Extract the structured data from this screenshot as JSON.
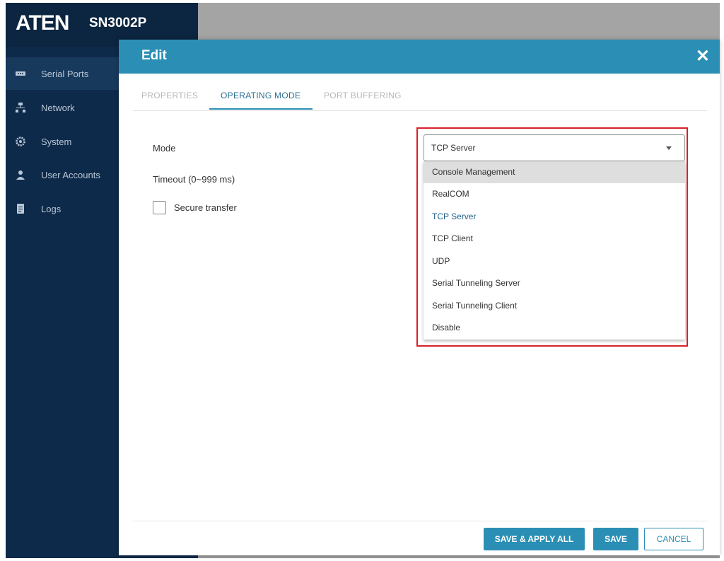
{
  "brand": {
    "logo": "ATEN",
    "model": "SN3002P"
  },
  "sidebar": {
    "items": [
      {
        "label": "Serial Ports",
        "icon": "serial-port-icon"
      },
      {
        "label": "Network",
        "icon": "network-icon"
      },
      {
        "label": "System",
        "icon": "gear-icon"
      },
      {
        "label": "User Accounts",
        "icon": "user-icon"
      },
      {
        "label": "Logs",
        "icon": "document-icon"
      }
    ]
  },
  "dialog": {
    "title": "Edit",
    "close_label": "✕",
    "tabs": [
      {
        "label": "PROPERTIES"
      },
      {
        "label": "OPERATING MODE"
      },
      {
        "label": "PORT BUFFERING"
      }
    ],
    "fields": {
      "mode_label": "Mode",
      "timeout_label": "Timeout (0~999 ms)",
      "secure_transfer_label": "Secure transfer"
    },
    "mode_select": {
      "value": "TCP Server",
      "options": [
        "Console Management",
        "RealCOM",
        "TCP Server",
        "TCP Client",
        "UDP",
        "Serial Tunneling Server",
        "Serial Tunneling Client",
        "Disable"
      ]
    },
    "buttons": {
      "save_apply_all": "SAVE & APPLY ALL",
      "save": "SAVE",
      "cancel": "CANCEL"
    }
  },
  "colors": {
    "accent": "#2b8fb5",
    "sidebar": "#0e2a4a",
    "highlight": "#d9202a"
  }
}
